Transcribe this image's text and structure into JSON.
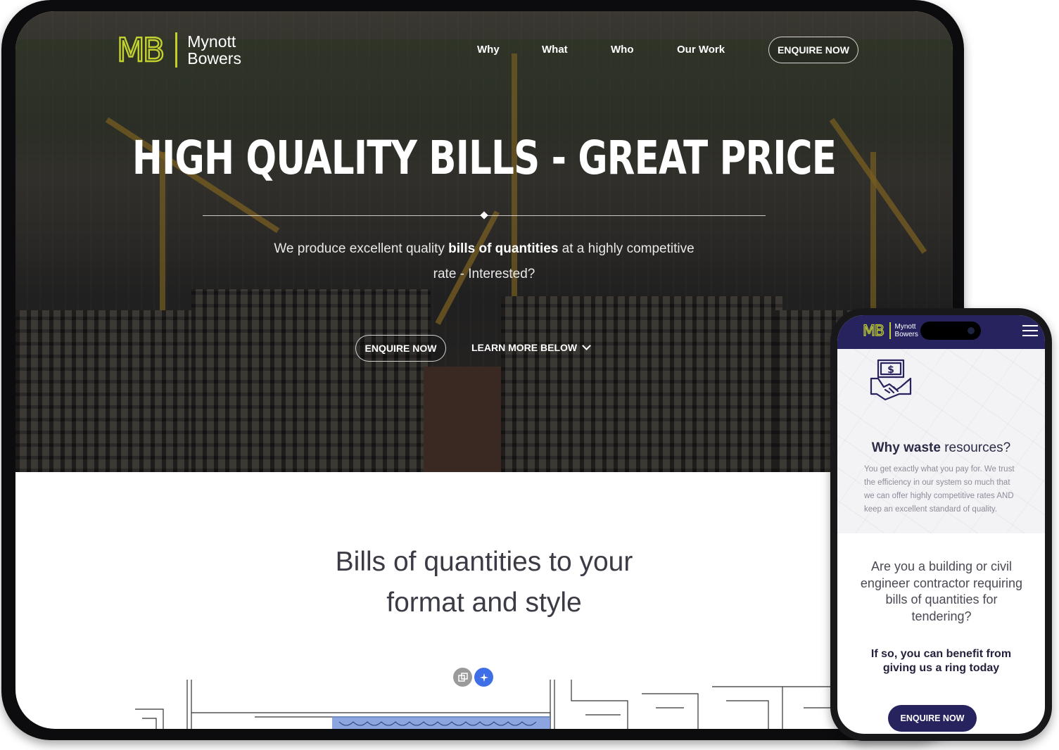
{
  "desktop": {
    "logo": {
      "mark": "MB",
      "line1": "Mynott",
      "line2": "Bowers"
    },
    "nav": {
      "items": [
        "Why",
        "What",
        "Who",
        "Our Work"
      ],
      "cta": "ENQUIRE NOW"
    },
    "hero": {
      "title": "HIGH QUALITY BILLS - GREAT PRICE",
      "subtitle_pre": "We produce excellent quality ",
      "subtitle_bold": "bills of quantities",
      "subtitle_post": " at a highly competitive rate - Interested?",
      "primary_button": "ENQUIRE NOW",
      "secondary_link": "LEARN MORE BELOW"
    },
    "section": {
      "heading_line1": "Bills of quantities to your",
      "heading_line2": "format and style"
    },
    "floating_icons": [
      "copy-icon",
      "sparkle-icon"
    ]
  },
  "mobile": {
    "logo": {
      "mark": "MB",
      "line1": "Mynott",
      "line2": "Bowers"
    },
    "card": {
      "icon": "handshake-money-icon",
      "title_bold": "Why waste",
      "title_rest": " resources?",
      "body": "You get exactly what you pay for. We trust the efficiency in our system so much that we can offer highly competitive rates AND keep an excellent standard of quality."
    },
    "question": "Are you a building or civil engineer contractor requiring bills of quantities for tendering?",
    "cta_text": "If so, you can benefit from giving us a ring today",
    "button": "ENQUIRE NOW"
  },
  "colors": {
    "brand_lime": "#c3d12f",
    "brand_navy": "#27235f",
    "accent_blue": "#3f6fe6"
  }
}
